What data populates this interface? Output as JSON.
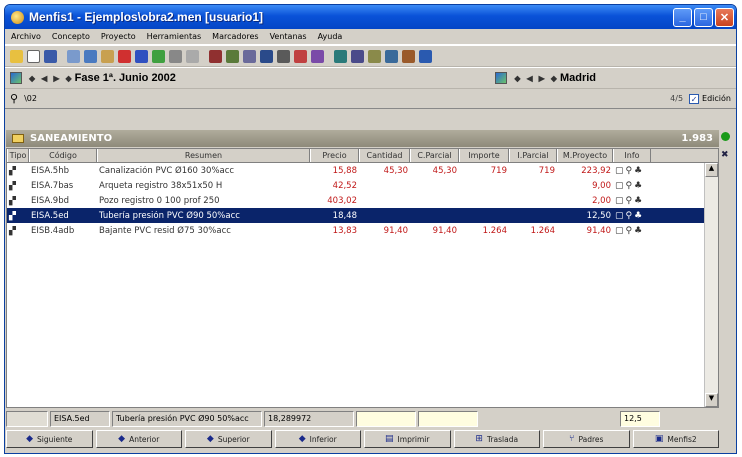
{
  "window": {
    "title": "Menfis1 - Ejemplos\\obra2.men   [usuario1]",
    "min": "_",
    "max": "□",
    "close": "✕"
  },
  "menu": [
    "Archivo",
    "Concepto",
    "Proyecto",
    "Herramientas",
    "Marcadores",
    "Ventanas",
    "Ayuda"
  ],
  "toolbar_icons": [
    "open-file",
    "new-file",
    "save",
    "cut",
    "copy",
    "paste",
    "undo",
    "redo",
    "find",
    "print",
    "preview",
    "calc",
    "tree",
    "grid",
    "chart",
    "table",
    "export",
    "import",
    "help",
    "info",
    "list",
    "settings"
  ],
  "phase": {
    "label": "Fase 1ª. Junio 2002",
    "location": "Madrid"
  },
  "code_search": {
    "value": "\\02",
    "count": "4/5",
    "edit_label": "Edición"
  },
  "chapter": {
    "name": "SANEAMIENTO",
    "total": "1.983"
  },
  "columns": [
    "Tipo",
    "Código",
    "Resumen",
    "Precio",
    "Cantidad",
    "C.Parcial",
    "Importe",
    "I.Parcial",
    "M.Proyecto",
    "Info"
  ],
  "rows": [
    {
      "code": "EISA.5hb",
      "summary": "Canalización PVC Ø160 30%acc",
      "price": "15,88",
      "qty": "45,30",
      "cparcial": "45,30",
      "importe": "719",
      "iparcial": "719",
      "mproy": "223,92",
      "selected": false
    },
    {
      "code": "EISA.7bas",
      "summary": "Arqueta registro 38x51x50 H",
      "price": "42,52",
      "qty": "",
      "cparcial": "",
      "importe": "",
      "iparcial": "",
      "mproy": "9,00",
      "selected": false
    },
    {
      "code": "EISA.9bd",
      "summary": "Pozo registro 0 100 prof 250",
      "price": "403,02",
      "qty": "",
      "cparcial": "",
      "importe": "",
      "iparcial": "",
      "mproy": "2,00",
      "selected": false
    },
    {
      "code": "EISA.5ed",
      "summary": "Tubería presión PVC Ø90 50%acc",
      "price": "18,48",
      "qty": "",
      "cparcial": "",
      "importe": "",
      "iparcial": "",
      "mproy": "12,50",
      "selected": true
    },
    {
      "code": "EISB.4adb",
      "summary": "Bajante PVC resid Ø75 30%acc",
      "price": "13,83",
      "qty": "91,40",
      "cparcial": "91,40",
      "importe": "1.264",
      "iparcial": "1.264",
      "mproy": "91,40",
      "selected": false
    }
  ],
  "status": {
    "code": "EISA.5ed",
    "summary": "Tubería presión PVC Ø90 50%acc",
    "price": "18,289972",
    "mproy": "12,5"
  },
  "buttons": [
    "Siguiente",
    "Anterior",
    "Superior",
    "Inferior",
    "Imprimir",
    "Traslada",
    "Padres",
    "Menfis2"
  ]
}
